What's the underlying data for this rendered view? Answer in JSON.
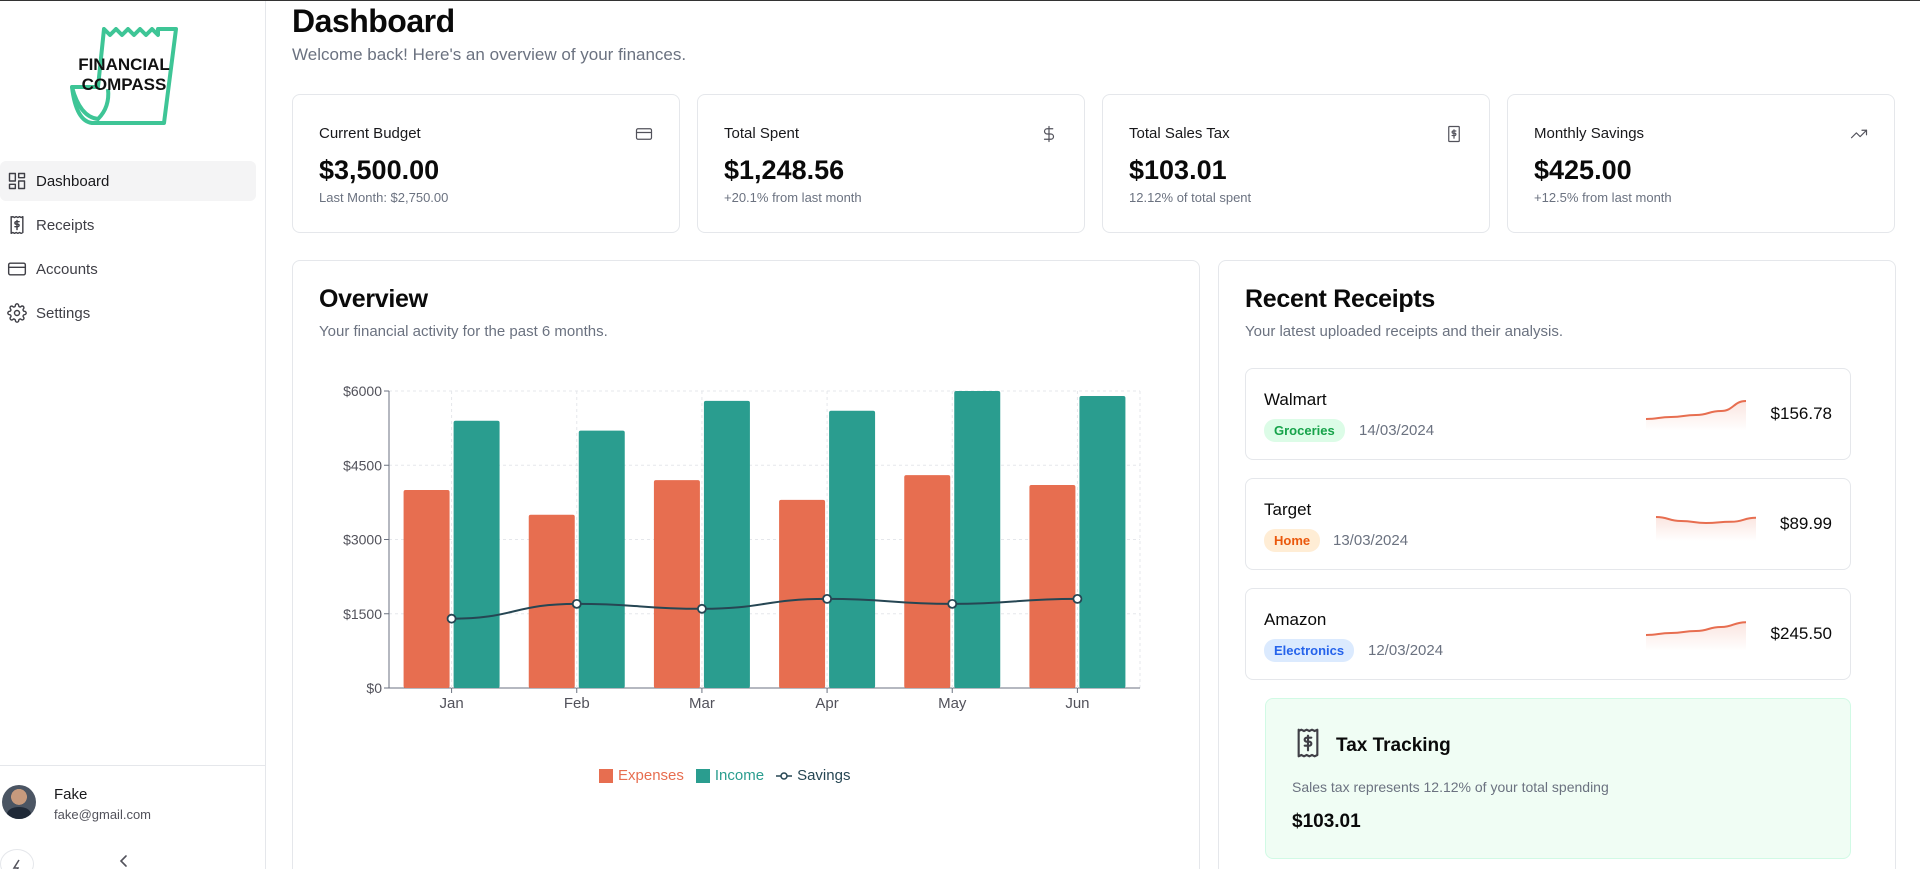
{
  "brand": {
    "logo_line1": "FINANCIAL",
    "logo_line2": "COMPASS",
    "color": "#3ec596"
  },
  "sidebar": {
    "items": [
      {
        "label": "Dashboard",
        "icon": "dashboard-icon",
        "active": true
      },
      {
        "label": "Receipts",
        "icon": "receipt-icon",
        "active": false
      },
      {
        "label": "Accounts",
        "icon": "credit-card-icon",
        "active": false
      },
      {
        "label": "Settings",
        "icon": "gear-icon",
        "active": false
      }
    ],
    "user": {
      "name": "Fake",
      "email": "fake@gmail.com"
    }
  },
  "header": {
    "title": "Dashboard",
    "subtitle": "Welcome back! Here's an overview of your finances."
  },
  "stats": [
    {
      "label": "Current Budget",
      "value": "$3,500.00",
      "note": "Last Month: $2,750.00",
      "icon": "credit-card-icon"
    },
    {
      "label": "Total Spent",
      "value": "$1,248.56",
      "note": "+20.1% from last month",
      "icon": "dollar-icon"
    },
    {
      "label": "Total Sales Tax",
      "value": "$103.01",
      "note": "12.12% of total spent",
      "icon": "receipt-icon"
    },
    {
      "label": "Monthly Savings",
      "value": "$425.00",
      "note": "+12.5% from last month",
      "icon": "trending-up-icon"
    }
  ],
  "overview": {
    "title": "Overview",
    "subtitle": "Your financial activity for the past 6 months."
  },
  "chart_data": {
    "type": "bar",
    "categories": [
      "Jan",
      "Feb",
      "Mar",
      "Apr",
      "May",
      "Jun"
    ],
    "series": [
      {
        "name": "Expenses",
        "kind": "bar",
        "color": "#e76e50",
        "values": [
          4000,
          3500,
          4200,
          3800,
          4300,
          4100
        ]
      },
      {
        "name": "Income",
        "kind": "bar",
        "color": "#2a9d8f",
        "values": [
          5400,
          5200,
          5800,
          5600,
          6000,
          5900
        ]
      },
      {
        "name": "Savings",
        "kind": "line",
        "color": "#264653",
        "values": [
          1400,
          1700,
          1600,
          1800,
          1700,
          1800
        ]
      }
    ],
    "yticks": [
      "$0",
      "$1500",
      "$3000",
      "$4500",
      "$6000"
    ],
    "ylim": [
      0,
      6000
    ],
    "grid": true,
    "legend": "bottom-center"
  },
  "receipts": {
    "title": "Recent Receipts",
    "subtitle": "Your latest uploaded receipts and their analysis.",
    "items": [
      {
        "store": "Walmart",
        "category": "Groceries",
        "date": "14/03/2024",
        "amount": "$156.78",
        "tag_bg": "#dcfce7",
        "tag_fg": "#16a34a",
        "trend": [
          0.3,
          0.35,
          0.4,
          0.5,
          0.75
        ]
      },
      {
        "store": "Target",
        "category": "Home",
        "date": "13/03/2024",
        "amount": "$89.99",
        "tag_bg": "#ffedd5",
        "tag_fg": "#ea580c",
        "trend": [
          0.6,
          0.5,
          0.45,
          0.48,
          0.58
        ]
      },
      {
        "store": "Amazon",
        "category": "Electronics",
        "date": "12/03/2024",
        "amount": "$245.50",
        "tag_bg": "#dbeafe",
        "tag_fg": "#2563eb",
        "trend": [
          0.4,
          0.45,
          0.5,
          0.6,
          0.72
        ]
      }
    ]
  },
  "tax": {
    "title": "Tax Tracking",
    "subtitle": "Sales tax represents 12.12% of your total spending",
    "value": "$103.01"
  }
}
